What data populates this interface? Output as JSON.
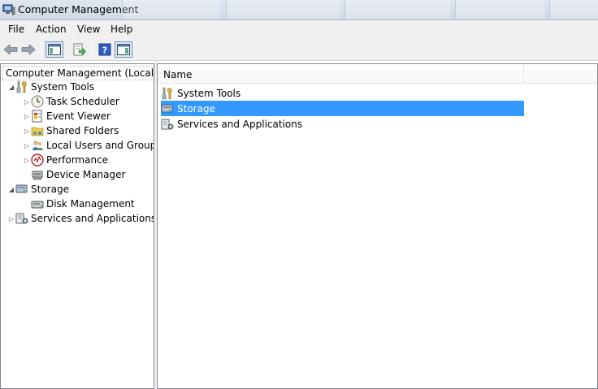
{
  "window": {
    "title": "Computer Management"
  },
  "menu": [
    "File",
    "Action",
    "View",
    "Help"
  ],
  "toolbar": {
    "buttons": [
      "back-arrow-icon",
      "forward-arrow-icon",
      "show-console-tree-icon",
      "export-list-icon",
      "help-icon",
      "show-action-pane-icon"
    ]
  },
  "tree": {
    "root": "Computer Management (Local",
    "items": [
      {
        "label": "System Tools",
        "icon": "tools-icon",
        "level": 1,
        "expander": "expanded"
      },
      {
        "label": "Task Scheduler",
        "icon": "clock-icon",
        "level": 2,
        "expander": "collapsed"
      },
      {
        "label": "Event Viewer",
        "icon": "event-log-icon",
        "level": 2,
        "expander": "collapsed"
      },
      {
        "label": "Shared Folders",
        "icon": "shared-folder-icon",
        "level": 2,
        "expander": "collapsed"
      },
      {
        "label": "Local Users and Groups",
        "icon": "users-icon",
        "level": 2,
        "expander": "collapsed"
      },
      {
        "label": "Performance",
        "icon": "performance-icon",
        "level": 2,
        "expander": "collapsed"
      },
      {
        "label": "Device Manager",
        "icon": "device-manager-icon",
        "level": 2,
        "expander": "none"
      },
      {
        "label": "Storage",
        "icon": "storage-icon",
        "level": 1,
        "expander": "expanded"
      },
      {
        "label": "Disk Management",
        "icon": "disk-icon",
        "level": 2,
        "expander": "none"
      },
      {
        "label": "Services and Applications",
        "icon": "services-icon",
        "level": 1,
        "expander": "collapsed"
      }
    ]
  },
  "list": {
    "column_name": "Name",
    "rows": [
      {
        "label": "System Tools",
        "icon": "tools-icon",
        "selected": false
      },
      {
        "label": "Storage",
        "icon": "storage-icon",
        "selected": true
      },
      {
        "label": "Services and Applications",
        "icon": "services-icon",
        "selected": false
      }
    ]
  },
  "colors": {
    "selection": "#3399ff",
    "titlebar": "#dfe6ee",
    "border": "#828790"
  }
}
